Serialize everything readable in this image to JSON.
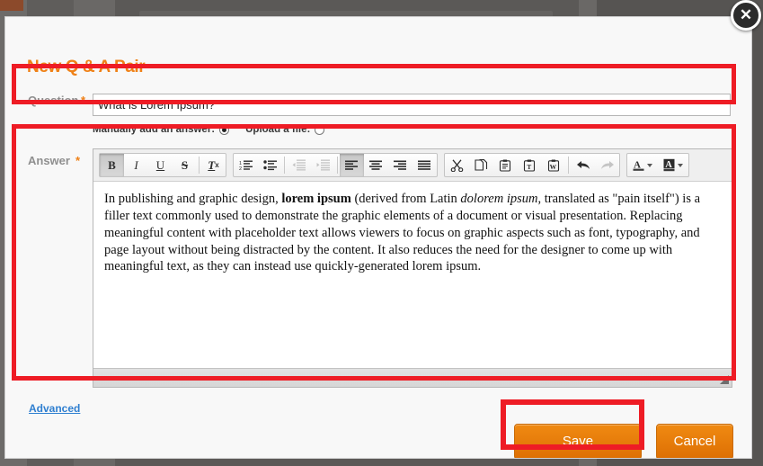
{
  "modal": {
    "title": "New Q & A Pair",
    "close_icon": "close-icon",
    "close_glyph": "✕"
  },
  "question": {
    "label": "Question",
    "required_marker": "*",
    "value": "What is Lorem Ipsum?",
    "placeholder": ""
  },
  "answer_source": {
    "manual_label": "Manually add an answer:",
    "upload_label": "Upload a file:",
    "manual_selected": true,
    "upload_selected": false
  },
  "answer": {
    "label": "Answer",
    "required_marker": "*",
    "body_html": "In publishing and graphic design, <b>lorem ipsum</b> (derived from Latin <i>dolorem ipsum</i>, translated as \"pain itself\") is a filler text commonly used to demonstrate the graphic elements of a document or visual presentation. Replacing meaningful content with placeholder text allows viewers to focus on graphic aspects such as font, typography, and page layout without being distracted by the content. It also reduces the need for the designer to come up with meaningful text, as they can instead use quickly-generated lorem ipsum.",
    "body_text": "In publishing and graphic design, lorem ipsum (derived from Latin dolorem ipsum, translated as \"pain itself\") is a filler text commonly used to demonstrate the graphic elements of a document or visual presentation. Replacing meaningful content with placeholder text allows viewers to focus on graphic aspects such as font, typography, and page layout without being distracted by the content. It also reduces the need for the designer to come up with meaningful text, as they can instead use quickly-generated lorem ipsum."
  },
  "toolbar": {
    "groups": [
      {
        "name": "text-format-group",
        "buttons": [
          {
            "name": "bold-button",
            "icon": "bold-icon",
            "label": "B",
            "active": true,
            "disabled": false
          },
          {
            "name": "italic-button",
            "icon": "italic-icon",
            "label": "I",
            "active": false,
            "disabled": false
          },
          {
            "name": "underline-button",
            "icon": "underline-icon",
            "label": "U",
            "active": false,
            "disabled": false
          },
          {
            "name": "strikethrough-button",
            "icon": "strikethrough-icon",
            "label": "S",
            "active": false,
            "disabled": false
          },
          {
            "name": "remove-format-button",
            "icon": "remove-format-icon",
            "label": "Tx",
            "active": false,
            "disabled": false
          }
        ]
      },
      {
        "name": "list-indent-align-group",
        "buttons": [
          {
            "name": "numbered-list-button",
            "icon": "numbered-list-icon",
            "label": "",
            "active": false,
            "disabled": false
          },
          {
            "name": "bulleted-list-button",
            "icon": "bulleted-list-icon",
            "label": "",
            "active": false,
            "disabled": false
          },
          {
            "name": "decrease-indent-button",
            "icon": "decrease-indent-icon",
            "label": "",
            "active": false,
            "disabled": true
          },
          {
            "name": "increase-indent-button",
            "icon": "increase-indent-icon",
            "label": "",
            "active": false,
            "disabled": true
          },
          {
            "name": "align-left-button",
            "icon": "align-left-icon",
            "label": "",
            "active": true,
            "disabled": false
          },
          {
            "name": "align-center-button",
            "icon": "align-center-icon",
            "label": "",
            "active": false,
            "disabled": false
          },
          {
            "name": "align-right-button",
            "icon": "align-right-icon",
            "label": "",
            "active": false,
            "disabled": false
          },
          {
            "name": "align-justify-button",
            "icon": "align-justify-icon",
            "label": "",
            "active": false,
            "disabled": false
          }
        ]
      },
      {
        "name": "clipboard-history-group",
        "buttons": [
          {
            "name": "cut-button",
            "icon": "scissors-icon",
            "label": "",
            "active": false,
            "disabled": false
          },
          {
            "name": "copy-button",
            "icon": "copy-icon",
            "label": "",
            "active": false,
            "disabled": false
          },
          {
            "name": "paste-button",
            "icon": "paste-icon",
            "label": "",
            "active": false,
            "disabled": false
          },
          {
            "name": "paste-as-text-button",
            "icon": "paste-text-icon",
            "label": "",
            "active": false,
            "disabled": false
          },
          {
            "name": "paste-from-word-button",
            "icon": "paste-word-icon",
            "label": "",
            "active": false,
            "disabled": false
          },
          {
            "name": "undo-button",
            "icon": "undo-arrow-icon",
            "label": "",
            "active": false,
            "disabled": false
          },
          {
            "name": "redo-button",
            "icon": "redo-arrow-icon",
            "label": "",
            "active": false,
            "disabled": true
          }
        ]
      },
      {
        "name": "color-group",
        "buttons": [
          {
            "name": "text-color-button",
            "icon": "text-color-icon",
            "label": "A",
            "active": false,
            "disabled": false
          },
          {
            "name": "background-color-button",
            "icon": "background-color-icon",
            "label": "A",
            "active": false,
            "disabled": false
          }
        ]
      }
    ]
  },
  "editor": {
    "resize_grip_icon": "resize-grip-icon"
  },
  "footer": {
    "advanced_label": "Advanced",
    "save_label": "Save",
    "cancel_label": "Cancel"
  },
  "colors": {
    "accent_orange": "#ef8117",
    "highlight_red": "#ee1c25",
    "link_blue": "#2f7fd0",
    "label_grey": "#8f8f8f",
    "modal_bg": "#f8f8f8",
    "overlay_grey": "#5a5856"
  }
}
